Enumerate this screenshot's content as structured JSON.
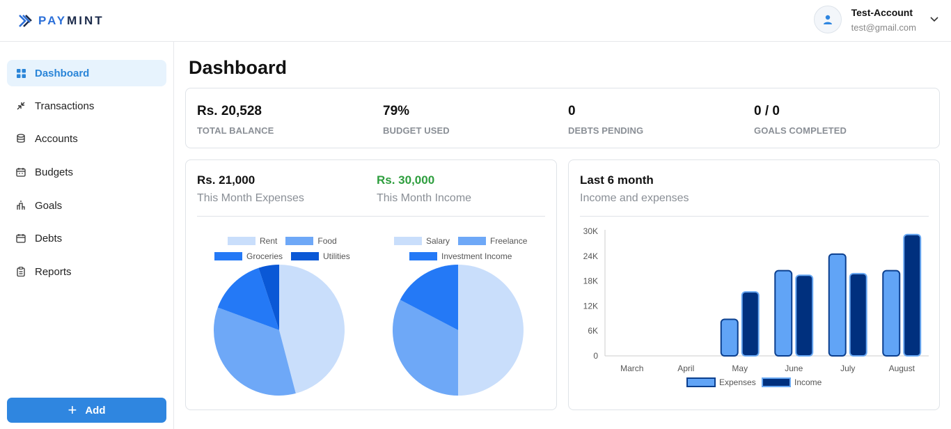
{
  "brand": {
    "pay": "PAY",
    "mint": "MINT"
  },
  "user": {
    "name": "Test-Account",
    "email": "test@gmail.com"
  },
  "sidebar": {
    "items": [
      {
        "label": "Dashboard",
        "icon": "dashboard-icon"
      },
      {
        "label": "Transactions",
        "icon": "transactions-icon"
      },
      {
        "label": "Accounts",
        "icon": "accounts-icon"
      },
      {
        "label": "Budgets",
        "icon": "budgets-icon"
      },
      {
        "label": "Goals",
        "icon": "goals-icon"
      },
      {
        "label": "Debts",
        "icon": "debts-icon"
      },
      {
        "label": "Reports",
        "icon": "reports-icon"
      }
    ],
    "add_label": "Add"
  },
  "page": {
    "title": "Dashboard"
  },
  "stats": [
    {
      "value": "Rs. 20,528",
      "label": "TOTAL BALANCE"
    },
    {
      "value": "79%",
      "label": "BUDGET USED"
    },
    {
      "value": "0",
      "label": "DEBTS PENDING"
    },
    {
      "value": "0 / 0",
      "label": "GOALS COMPLETED"
    }
  ],
  "month_card": {
    "expenses_value": "Rs. 21,000",
    "expenses_label": "This Month Expenses",
    "income_value": "Rs. 30,000",
    "income_label": "This Month Income"
  },
  "history_card": {
    "title": "Last 6 month",
    "subtitle": "Income and expenses"
  },
  "colors": {
    "accent": "#2f86e0",
    "green": "#2e9e3e",
    "light": "#c9defb",
    "mid": "#6ea8f7",
    "strong": "#2479f6",
    "deep": "#0a58d6",
    "navy": "#00307e"
  },
  "chart_data": [
    {
      "type": "pie",
      "legend": [
        "Rent",
        "Food",
        "Groceries",
        "Utilities"
      ],
      "labels": [
        "Rent",
        "Food",
        "Groceries",
        "Utilities"
      ],
      "values": [
        45,
        34,
        14,
        5
      ],
      "colors": [
        "#c9defb",
        "#6ea8f7",
        "#2479f6",
        "#0a58d6"
      ]
    },
    {
      "type": "pie",
      "legend": [
        "Salary",
        "Freelance",
        "Investment Income"
      ],
      "labels": [
        "Salary",
        "Freelance",
        "Investment Income"
      ],
      "values": [
        15000,
        9800,
        5200
      ],
      "colors": [
        "#c9defb",
        "#6ea8f7",
        "#2479f6"
      ]
    },
    {
      "type": "bar",
      "categories": [
        "March",
        "April",
        "May",
        "June",
        "July",
        "August"
      ],
      "series": [
        {
          "name": "Expenses",
          "values": [
            0,
            0,
            8800,
            20500,
            24500,
            20500
          ],
          "color": "#61a4f6"
        },
        {
          "name": "Income",
          "values": [
            0,
            0,
            15400,
            19400,
            19800,
            29200
          ],
          "color": "#00307e"
        }
      ],
      "yticks": [
        "0",
        "6K",
        "12K",
        "18K",
        "24K",
        "30K"
      ],
      "ylim": [
        0,
        30000
      ],
      "legend": "bottom"
    }
  ]
}
